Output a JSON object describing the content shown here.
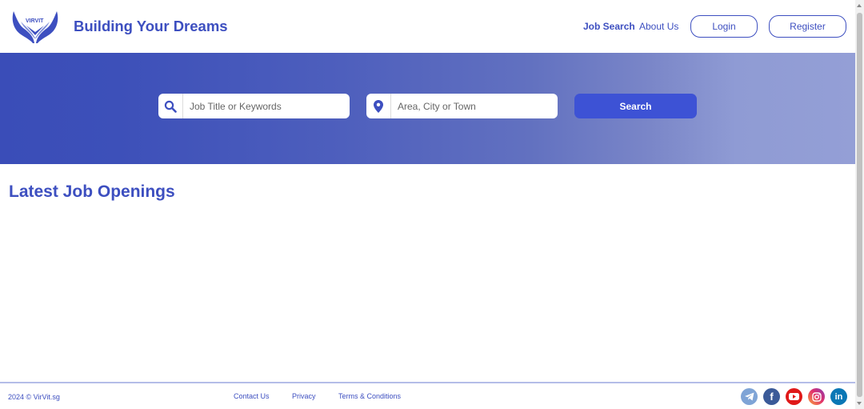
{
  "header": {
    "logo_text": "VIRVIT",
    "brand": "Building Your Dreams",
    "nav": {
      "job_search": "Job Search",
      "about_us": "About Us",
      "login": "Login",
      "register": "Register"
    }
  },
  "hero": {
    "keyword_placeholder": "Job Title or Keywords",
    "location_placeholder": "Area, City or Town",
    "search_label": "Search"
  },
  "main": {
    "title": "Latest Job Openings"
  },
  "footer": {
    "copyright": "2024 © VirVit.sg",
    "links": {
      "contact": "Contact Us",
      "privacy": "Privacy",
      "terms": "Terms & Conditions"
    }
  },
  "social_icons": [
    "telegram-icon",
    "facebook-icon",
    "youtube-icon",
    "instagram-icon",
    "linkedin-icon"
  ],
  "colors": {
    "brand": "#3d4fc0",
    "button": "#3d52d5",
    "hero_start": "#3a4db8",
    "hero_end": "#949fd6"
  }
}
